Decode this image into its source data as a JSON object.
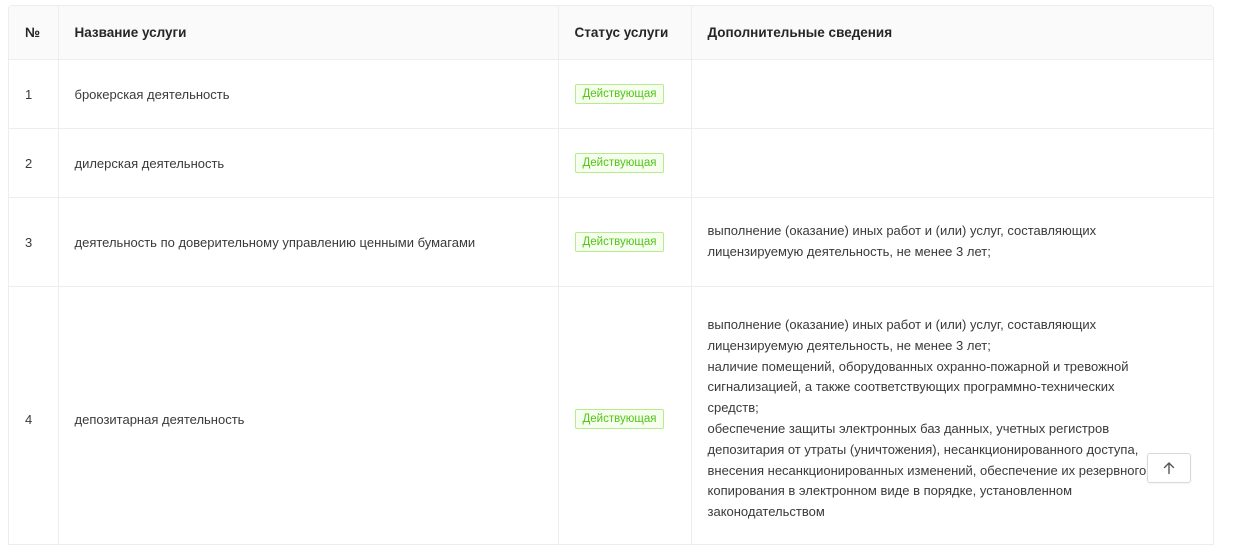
{
  "table": {
    "headers": {
      "number": "№",
      "name": "Название услуги",
      "status": "Статус услуги",
      "info": "Дополнительные сведения"
    },
    "rows": [
      {
        "number": "1",
        "name": "брокерская деятельность",
        "status": "Действующая",
        "info": []
      },
      {
        "number": "2",
        "name": "дилерская деятельность",
        "status": "Действующая",
        "info": []
      },
      {
        "number": "3",
        "name": "деятельность по доверительному управлению ценными бумагами",
        "status": "Действующая",
        "info": [
          "выполнение (оказание) иных работ и (или) услуг, составляющих",
          "лицензируемую деятельность, не менее 3 лет;"
        ]
      },
      {
        "number": "4",
        "name": "депозитарная деятельность",
        "status": "Действующая",
        "info": [
          "выполнение (оказание) иных работ и (или) услуг, составляющих",
          "лицензируемую деятельность, не менее 3 лет;",
          "наличие помещений, оборудованных охранно-пожарной и тревожной",
          "сигнализацией, а также соответствующих программно-технических",
          "средств;",
          "обеспечение защиты электронных баз данных, учетных регистров",
          "депозитария от утраты (уничтожения), несанкционированного доступа,",
          "внесения несанкционированных изменений, обеспечение их резервного",
          "копирования в электронном виде в порядке, установленном",
          "законодательством"
        ]
      }
    ]
  },
  "colors": {
    "status_active_text": "#52c41a",
    "status_active_border": "#b7eb8f",
    "status_active_bg": "#f6ffed",
    "header_bg": "#fafafa",
    "border": "#ededed"
  },
  "icons": {
    "scroll_top": "arrow-up-icon"
  }
}
